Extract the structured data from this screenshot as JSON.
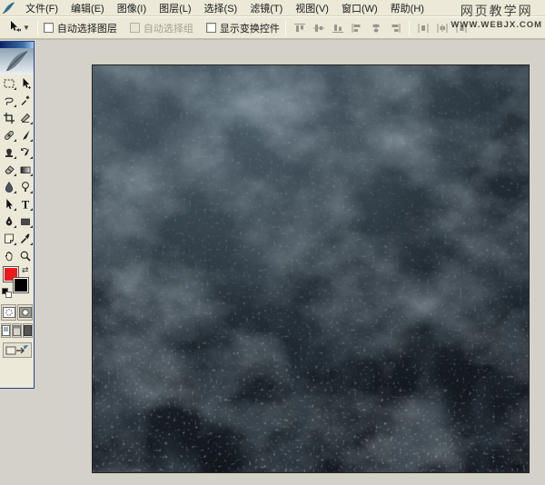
{
  "watermark": {
    "line1": "网页教学网",
    "line2": "WWW.WEBJX.COM"
  },
  "menu": {
    "items": [
      {
        "id": "file",
        "label": "文件(F)"
      },
      {
        "id": "edit",
        "label": "编辑(E)"
      },
      {
        "id": "image",
        "label": "图像(I)"
      },
      {
        "id": "layer",
        "label": "图层(L)"
      },
      {
        "id": "select",
        "label": "选择(S)"
      },
      {
        "id": "filter",
        "label": "滤镜(T)"
      },
      {
        "id": "view",
        "label": "视图(V)"
      },
      {
        "id": "window",
        "label": "窗口(W)"
      },
      {
        "id": "help",
        "label": "帮助(H)"
      }
    ]
  },
  "options_bar": {
    "active_tool_icon": "move-tool-icon",
    "checkboxes": [
      {
        "id": "auto-select-layer",
        "label": "自动选择图层",
        "checked": false,
        "disabled": false
      },
      {
        "id": "auto-select-group",
        "label": "自动选择组",
        "checked": false,
        "disabled": true
      },
      {
        "id": "show-transform-controls",
        "label": "显示变换控件",
        "checked": false,
        "disabled": false
      }
    ],
    "align_buttons": [
      {
        "id": "align-top-edges"
      },
      {
        "id": "align-vertical-centers"
      },
      {
        "id": "align-bottom-edges"
      },
      {
        "id": "align-left-edges"
      },
      {
        "id": "align-horizontal-centers"
      },
      {
        "id": "align-right-edges"
      }
    ],
    "distribute_buttons": [
      {
        "id": "distribute-left-edges"
      },
      {
        "id": "distribute-horizontal-centers"
      },
      {
        "id": "distribute-right-edges"
      }
    ],
    "buttons_enabled": false
  },
  "toolbox": {
    "tools": [
      {
        "id": "rectangular-marquee",
        "icon": "marquee-icon",
        "flyout": true
      },
      {
        "id": "move",
        "icon": "move-icon",
        "flyout": false
      },
      {
        "id": "lasso",
        "icon": "lasso-icon",
        "flyout": true
      },
      {
        "id": "magic-wand",
        "icon": "wand-icon",
        "flyout": false
      },
      {
        "id": "crop",
        "icon": "crop-icon",
        "flyout": false
      },
      {
        "id": "slice",
        "icon": "slice-icon",
        "flyout": true
      },
      {
        "id": "healing-brush",
        "icon": "healing-icon",
        "flyout": true
      },
      {
        "id": "brush",
        "icon": "brush-icon",
        "flyout": true
      },
      {
        "id": "clone-stamp",
        "icon": "stamp-icon",
        "flyout": true
      },
      {
        "id": "history-brush",
        "icon": "history-brush-icon",
        "flyout": true
      },
      {
        "id": "eraser",
        "icon": "eraser-icon",
        "flyout": true
      },
      {
        "id": "gradient",
        "icon": "gradient-icon",
        "flyout": true
      },
      {
        "id": "blur",
        "icon": "blur-icon",
        "flyout": true
      },
      {
        "id": "dodge",
        "icon": "dodge-icon",
        "flyout": true
      },
      {
        "id": "path-selection",
        "icon": "path-select-icon",
        "flyout": true
      },
      {
        "id": "type",
        "icon": "type-icon",
        "flyout": true
      },
      {
        "id": "pen",
        "icon": "pen-icon",
        "flyout": true
      },
      {
        "id": "shape",
        "icon": "shape-icon",
        "flyout": true
      },
      {
        "id": "notes",
        "icon": "notes-icon",
        "flyout": true
      },
      {
        "id": "eyedropper",
        "icon": "eyedropper-icon",
        "flyout": true
      },
      {
        "id": "hand",
        "icon": "hand-icon",
        "flyout": false
      },
      {
        "id": "zoom",
        "icon": "zoom-icon",
        "flyout": false
      }
    ],
    "colors": {
      "foreground": "#ee1a1a",
      "background": "#000000"
    }
  },
  "canvas": {
    "texture_colors": {
      "dark": "#141a1f",
      "mid": "#26313a",
      "light": "#7d93a0",
      "speckle": "#a9bcc6"
    }
  },
  "ui_colors": {
    "menu_bg": "#ece9d8",
    "workarea_bg": "#d4d1c8",
    "titlebar_blue": "#0a246a"
  }
}
